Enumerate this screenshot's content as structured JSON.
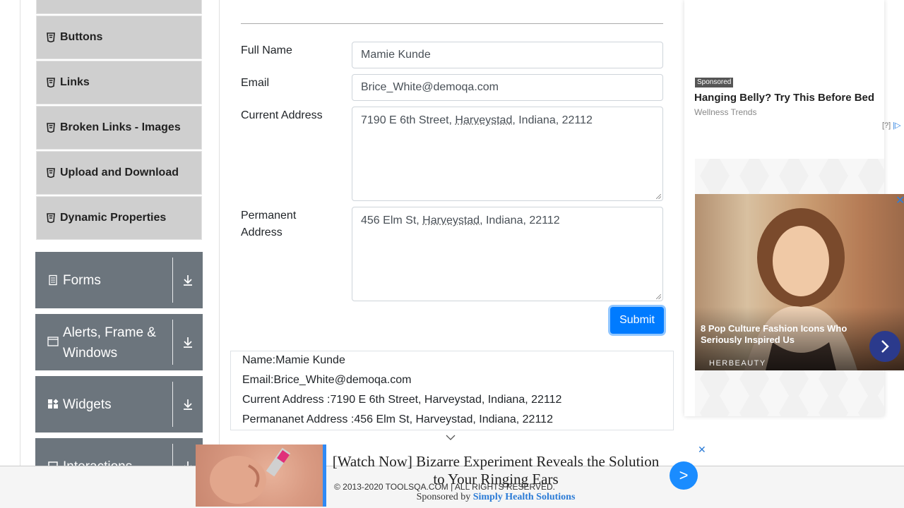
{
  "sidebar": {
    "items": [
      {
        "label": ""
      },
      {
        "label": "Buttons"
      },
      {
        "label": "Links"
      },
      {
        "label": "Broken Links - Images"
      },
      {
        "label": "Upload and Download"
      },
      {
        "label": "Dynamic Properties"
      }
    ],
    "groups": [
      {
        "label": "Forms"
      },
      {
        "label": "Alerts, Frame & Windows"
      },
      {
        "label": "Widgets"
      },
      {
        "label": "Interactions"
      }
    ]
  },
  "form": {
    "full_name_label": "Full Name",
    "full_name_value": "Mamie Kunde",
    "email_label": "Email",
    "email_value": "Brice_White@demoqa.com",
    "current_address_label": "Current Address",
    "current_address_pre": "7190 E 6th Street, ",
    "current_address_city": "Harveystad",
    "current_address_post": ", Indiana, 22112",
    "permanent_address_label": "Permanent Address",
    "permanent_address_pre": "456 Elm St, ",
    "permanent_address_city": "Harveystad",
    "permanent_address_post": ", Indiana, 22112",
    "submit_label": "Submit"
  },
  "output": {
    "name": "Name:Mamie Kunde",
    "email": "Email:Brice_White@demoqa.com",
    "current": "Current Address :7190 E 6th Street, Harveystad, Indiana, 22112",
    "permanent": "Permananet Address :456 Elm St, Harveystad, Indiana, 22112"
  },
  "ad_right": {
    "badge": "Sponsored",
    "title": "Hanging Belly? Try This Before Bed",
    "source": "Wellness Trends",
    "help": "[?]",
    "photo_caption": "8 Pop Culture Fashion Icons Who Seriously Inspired Us",
    "photo_brand": "HERBEAUTY",
    "close": "✕"
  },
  "ad_bottom": {
    "title": "[Watch Now] Bizarre Experiment Reveals the Solution to Your Ringing Ears",
    "sponsored_prefix": "Sponsored by ",
    "sponsor": "Simply Health Solutions",
    "go": ">",
    "close": "✕"
  },
  "footer": {
    "copyright": "© 2013-2020 TOOLSQA.COM | ALL RIGHTS RESERVED."
  },
  "colors": {
    "primary": "#007bff",
    "sidebar_group": "#6c757d",
    "sidebar_item": "#cfcfcf"
  }
}
